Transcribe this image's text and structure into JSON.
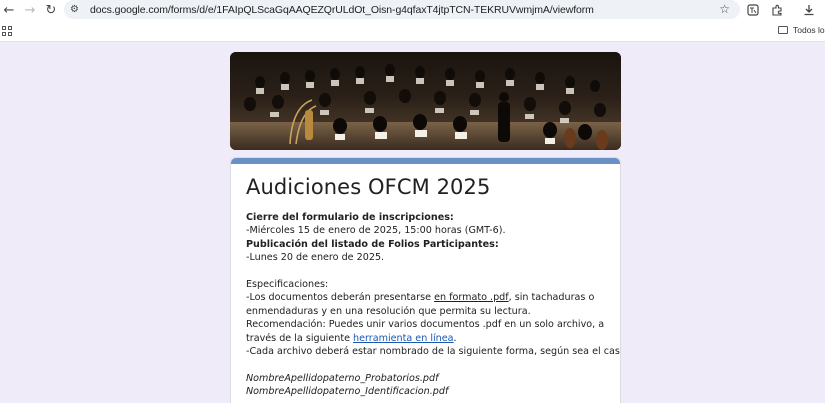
{
  "browser": {
    "url": "docs.google.com/forms/d/e/1FAIpQLScaGqAAQEZQrULdOt_Oisn-g4qfaxT4jtpTCN-TEKRUVwmjmA/viewform",
    "bookmarks_label": "Todos los"
  },
  "form": {
    "title": "Audiciones OFCM 2025",
    "lines": {
      "cierre_heading": "Cierre del formulario de inscripciones:",
      "cierre_date": "-Miércoles 15 de enero de 2025, 15:00 horas (GMT-6).",
      "publicacion_heading": "Publicación del listado de Folios Participantes:",
      "publicacion_date": "-Lunes 20 de enero de 2025.",
      "especificaciones": "Especificaciones:",
      "docs_pre": "-Los documentos deberán presentarse ",
      "docs_link": "en formato .pdf",
      "docs_post": ", sin tachaduras o",
      "docs_line2": "enmendaduras y en una resolución que permita su lectura.",
      "recom_line1": "Recomendación: Puedes unir varios documentos .pdf en un solo archivo, a",
      "recom_pre": "través de la siguiente ",
      "recom_link": "herramienta en línea",
      "recom_post": ".",
      "cada_archivo": "-Cada archivo deberá estar nombrado de la siguiente forma, según sea el caso:",
      "file1": "NombreApellidopaterno_Probatorios.pdf",
      "file2": "NombreApellidopaterno_Identificacion.pdf"
    }
  }
}
